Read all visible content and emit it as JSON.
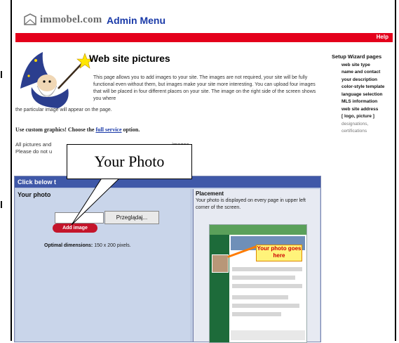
{
  "header": {
    "logo_text": "immobel.com",
    "menu_title": "Admin Menu",
    "help_label": "Help"
  },
  "page": {
    "title": "Web site pictures",
    "intro": "This page allows you to add images to your site. The images are not required, your site will be fully functional even without them, but images make your site more interesting. You can upload four images that will be placed in four different places on your site. The image on the right side of the screen shows you where",
    "intro_cont": "the particular image will appear on the page.",
    "custom_prefix": "Use custom graphics! Choose the",
    "custom_link": "full service",
    "custom_suffix": "option.",
    "pictures_line1": "All pictures and",
    "pictures_line1_end": "images.",
    "pictures_line2": "Please do not u"
  },
  "wizard": {
    "title": "Setup Wizard pages",
    "items": [
      {
        "label": "web site type",
        "style": "main"
      },
      {
        "label": "name and contact",
        "style": "main"
      },
      {
        "label": "your description",
        "style": "main"
      },
      {
        "label": "color-style template",
        "style": "main"
      },
      {
        "label": "language selection",
        "style": "main"
      },
      {
        "label": "MLS information",
        "style": "main"
      },
      {
        "label": "web site address",
        "style": "main"
      },
      {
        "label": "[ logo, picture ]",
        "style": "current"
      },
      {
        "label": "designations,",
        "style": "sub"
      },
      {
        "label": "certifications",
        "style": "sub"
      }
    ]
  },
  "panel": {
    "header": "Click below t",
    "your_photo_label": "Your photo",
    "browse_label": "Przeglądaj...",
    "add_label": "Add image",
    "optimal_label": "Optimal dimensions:",
    "optimal_value": "150 x 200 pixels.",
    "placement_title": "Placement",
    "placement_text": "Your photo is displayed on every page in upper left corner of the screen.",
    "preview_callout": "Your photo goes here"
  },
  "callout": {
    "text": "Your Photo"
  },
  "colors": {
    "accent_red": "#e4001b",
    "link_blue": "#1a3aa8",
    "panel_header": "#3f58a8"
  }
}
